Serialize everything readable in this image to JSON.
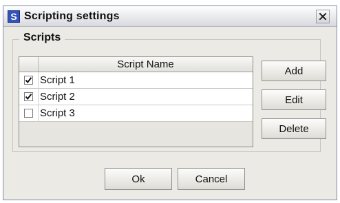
{
  "window": {
    "icon_letter": "S",
    "title": "Scripting settings"
  },
  "scripts_group": {
    "legend": "Scripts",
    "table": {
      "column_header": "Script Name",
      "rows": [
        {
          "name": "Script 1",
          "checked": true
        },
        {
          "name": "Script 2",
          "checked": true
        },
        {
          "name": "Script 3",
          "checked": false
        }
      ]
    }
  },
  "buttons": {
    "add": "Add",
    "edit": "Edit",
    "delete": "Delete",
    "ok": "Ok",
    "cancel": "Cancel"
  },
  "icons": {
    "app": "app-s-icon",
    "close": "close-icon",
    "check": "checkmark-icon"
  }
}
